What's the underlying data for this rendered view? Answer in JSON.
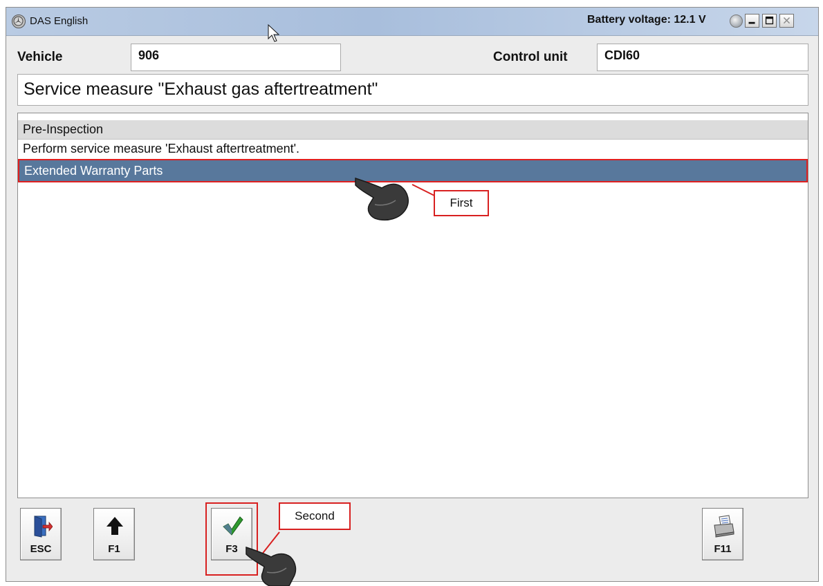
{
  "window": {
    "title": "DAS English",
    "battery_label": "Battery voltage: 12.1 V"
  },
  "header": {
    "vehicle_label": "Vehicle",
    "vehicle_value": "906",
    "control_unit_label": "Control unit",
    "control_unit_value": "CDI60"
  },
  "heading": "Service measure \"Exhaust gas aftertreatment\"",
  "list": {
    "header": "Pre-Inspection",
    "items": [
      {
        "label": "Perform service measure 'Exhaust aftertreatment'.",
        "selected": false
      },
      {
        "label": "Extended Warranty Parts",
        "selected": true
      }
    ]
  },
  "annotations": {
    "first": "First",
    "second": "Second",
    "color": "#d82020"
  },
  "toolbar": {
    "esc": "ESC",
    "f1": "F1",
    "f3": "F3",
    "f11": "F11"
  },
  "colors": {
    "selection": "#58789c",
    "titlebar": "#a8bedc"
  },
  "icons": [
    "mercedes-star-icon",
    "gear-icon",
    "minimize-icon",
    "maximize-icon",
    "close-icon",
    "exit-door-icon",
    "up-arrow-icon",
    "checkmark-icon",
    "printer-icon",
    "pointing-hand-icon",
    "mouse-cursor-icon"
  ]
}
